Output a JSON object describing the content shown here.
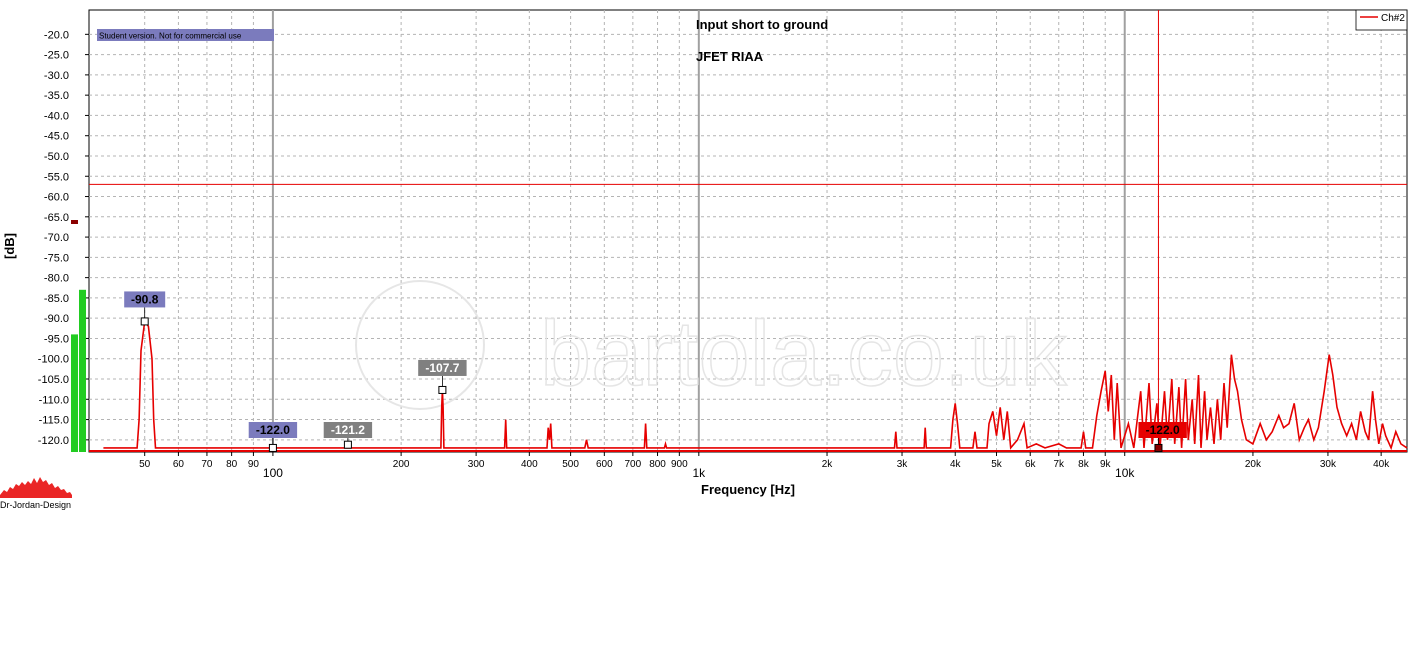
{
  "chart_data": {
    "type": "line",
    "xlabel": "Frequency [Hz]",
    "ylabel": "[dB]",
    "xscale": "log",
    "xlim": [
      37,
      46000
    ],
    "ylim": [
      -123,
      -14
    ],
    "grid": true,
    "annotations": [
      "Input short to ground",
      "JFET RIAA"
    ],
    "student_banner": "Student version. Not for commercial use",
    "watermark": "bartola.co.uk",
    "brand": "Dr-Jordan-Design",
    "legend": {
      "position": "top-right",
      "entries": [
        "Ch#2"
      ]
    },
    "colors": {
      "series": "#e60000",
      "cursor": "#e60000",
      "banner_bg": "#7b7bbd",
      "marker_blue": "#7b7bbd",
      "marker_gray": "#808080",
      "marker_red": "#e60000",
      "meter": "#22cc22"
    },
    "y_ticks": [
      -20,
      -25,
      -30,
      -35,
      -40,
      -45,
      -50,
      -55,
      -60,
      -65,
      -70,
      -75,
      -80,
      -85,
      -90,
      -95,
      -100,
      -105,
      -110,
      -115,
      -120
    ],
    "y_tick_labels": [
      "-20.0",
      "-25.0",
      "-30.0",
      "-35.0",
      "-40.0",
      "-45.0",
      "-50.0",
      "-55.0",
      "-60.0",
      "-65.0",
      "-70.0",
      "-75.0",
      "-80.0",
      "-85.0",
      "-90.0",
      "-95.0",
      "-100.0",
      "-105.0",
      "-110.0",
      "-115.0",
      "-120.0"
    ],
    "x_ticks": [
      {
        "v": 50,
        "label": "50"
      },
      {
        "v": 60,
        "label": "60"
      },
      {
        "v": 70,
        "label": "70"
      },
      {
        "v": 80,
        "label": "80"
      },
      {
        "v": 90,
        "label": "90"
      },
      {
        "v": 100,
        "label": "100",
        "major": true
      },
      {
        "v": 200,
        "label": "200"
      },
      {
        "v": 300,
        "label": "300"
      },
      {
        "v": 400,
        "label": "400"
      },
      {
        "v": 500,
        "label": "500"
      },
      {
        "v": 600,
        "label": "600"
      },
      {
        "v": 700,
        "label": "700"
      },
      {
        "v": 800,
        "label": "800"
      },
      {
        "v": 900,
        "label": "900"
      },
      {
        "v": 1000,
        "label": "1k",
        "major": true
      },
      {
        "v": 2000,
        "label": "2k"
      },
      {
        "v": 3000,
        "label": "3k"
      },
      {
        "v": 4000,
        "label": "4k"
      },
      {
        "v": 5000,
        "label": "5k"
      },
      {
        "v": 6000,
        "label": "6k"
      },
      {
        "v": 7000,
        "label": "7k"
      },
      {
        "v": 8000,
        "label": "8k"
      },
      {
        "v": 9000,
        "label": "9k"
      },
      {
        "v": 10000,
        "label": "10k",
        "major": true
      },
      {
        "v": 20000,
        "label": "20k"
      },
      {
        "v": 30000,
        "label": "30k"
      },
      {
        "v": 40000,
        "label": "40k"
      }
    ],
    "cursor": {
      "x": 12000,
      "y": -57
    },
    "markers": [
      {
        "x": 50,
        "y": -90.8,
        "label": "-90.8",
        "style": "blue"
      },
      {
        "x": 100,
        "y": -122.0,
        "label": "-122.0",
        "style": "blue"
      },
      {
        "x": 150,
        "y": -121.2,
        "label": "-121.2",
        "style": "gray"
      },
      {
        "x": 250,
        "y": -107.7,
        "label": "-107.7",
        "style": "gray"
      },
      {
        "x": 12000,
        "y": -122.0,
        "label": "-122.0",
        "style": "red"
      }
    ],
    "meters": [
      -94,
      -83
    ],
    "series": [
      {
        "name": "Ch#2",
        "points": [
          [
            40,
            -122
          ],
          [
            48,
            -122
          ],
          [
            48.5,
            -115
          ],
          [
            49,
            -98
          ],
          [
            50,
            -90.8
          ],
          [
            51,
            -92
          ],
          [
            52,
            -100
          ],
          [
            52.5,
            -115
          ],
          [
            53,
            -122
          ],
          [
            248,
            -122
          ],
          [
            249,
            -112
          ],
          [
            250,
            -107.7
          ],
          [
            251,
            -112
          ],
          [
            252,
            -122
          ],
          [
            350,
            -122
          ],
          [
            352,
            -115
          ],
          [
            354,
            -122
          ],
          [
            440,
            -122
          ],
          [
            443,
            -117
          ],
          [
            446,
            -120
          ],
          [
            449,
            -116
          ],
          [
            452,
            -122
          ],
          [
            540,
            -122
          ],
          [
            545,
            -120
          ],
          [
            550,
            -122
          ],
          [
            745,
            -122
          ],
          [
            750,
            -116
          ],
          [
            755,
            -122
          ],
          [
            830,
            -122
          ],
          [
            835,
            -121
          ],
          [
            840,
            -122
          ],
          [
            2880,
            -122
          ],
          [
            2900,
            -118
          ],
          [
            2920,
            -122
          ],
          [
            3380,
            -122
          ],
          [
            3400,
            -117
          ],
          [
            3420,
            -122
          ],
          [
            3900,
            -122
          ],
          [
            3950,
            -115
          ],
          [
            4000,
            -111
          ],
          [
            4050,
            -116
          ],
          [
            4100,
            -122
          ],
          [
            4400,
            -122
          ],
          [
            4450,
            -118
          ],
          [
            4500,
            -122
          ],
          [
            4750,
            -122
          ],
          [
            4800,
            -116
          ],
          [
            4900,
            -113
          ],
          [
            5000,
            -119
          ],
          [
            5100,
            -112
          ],
          [
            5200,
            -120
          ],
          [
            5300,
            -113
          ],
          [
            5400,
            -122
          ],
          [
            5600,
            -120
          ],
          [
            5800,
            -116
          ],
          [
            5900,
            -122
          ],
          [
            6200,
            -121
          ],
          [
            6500,
            -122
          ],
          [
            7000,
            -121
          ],
          [
            7300,
            -122
          ],
          [
            7900,
            -122
          ],
          [
            8000,
            -118
          ],
          [
            8100,
            -122
          ],
          [
            8400,
            -122
          ],
          [
            8600,
            -114
          ],
          [
            8800,
            -108
          ],
          [
            9000,
            -103
          ],
          [
            9150,
            -113
          ],
          [
            9300,
            -104
          ],
          [
            9450,
            -120
          ],
          [
            9600,
            -106
          ],
          [
            9800,
            -122
          ],
          [
            10200,
            -116
          ],
          [
            10500,
            -122
          ],
          [
            10900,
            -108
          ],
          [
            11100,
            -122
          ],
          [
            11400,
            -106
          ],
          [
            11600,
            -121
          ],
          [
            11900,
            -111
          ],
          [
            12100,
            -122
          ],
          [
            12400,
            -108
          ],
          [
            12600,
            -120
          ],
          [
            12900,
            -105
          ],
          [
            13100,
            -121
          ],
          [
            13400,
            -107
          ],
          [
            13600,
            -122
          ],
          [
            13900,
            -105
          ],
          [
            14100,
            -120
          ],
          [
            14400,
            -110
          ],
          [
            14600,
            -121
          ],
          [
            14900,
            -104
          ],
          [
            15100,
            -122
          ],
          [
            15400,
            -108
          ],
          [
            15600,
            -120
          ],
          [
            15900,
            -112
          ],
          [
            16200,
            -121
          ],
          [
            16500,
            -110
          ],
          [
            16800,
            -120
          ],
          [
            17100,
            -106
          ],
          [
            17400,
            -117
          ],
          [
            17800,
            -99
          ],
          [
            18100,
            -105
          ],
          [
            18400,
            -108
          ],
          [
            18800,
            -115
          ],
          [
            19300,
            -120
          ],
          [
            20000,
            -121
          ],
          [
            20800,
            -116
          ],
          [
            21500,
            -120
          ],
          [
            22200,
            -118
          ],
          [
            23000,
            -114
          ],
          [
            23600,
            -117
          ],
          [
            24300,
            -116
          ],
          [
            25000,
            -111
          ],
          [
            25700,
            -120
          ],
          [
            26400,
            -117
          ],
          [
            27000,
            -115
          ],
          [
            27800,
            -120
          ],
          [
            28500,
            -117
          ],
          [
            29400,
            -108
          ],
          [
            30200,
            -99
          ],
          [
            30800,
            -104
          ],
          [
            31500,
            -112
          ],
          [
            32300,
            -116
          ],
          [
            33200,
            -119
          ],
          [
            34100,
            -116
          ],
          [
            35000,
            -120
          ],
          [
            35800,
            -113
          ],
          [
            36700,
            -118
          ],
          [
            37400,
            -120
          ],
          [
            38200,
            -108
          ],
          [
            38800,
            -115
          ],
          [
            39500,
            -121
          ],
          [
            40300,
            -116
          ],
          [
            41000,
            -119
          ],
          [
            42200,
            -122
          ],
          [
            43300,
            -118
          ],
          [
            44500,
            -121
          ],
          [
            46000,
            -122
          ]
        ]
      }
    ]
  }
}
